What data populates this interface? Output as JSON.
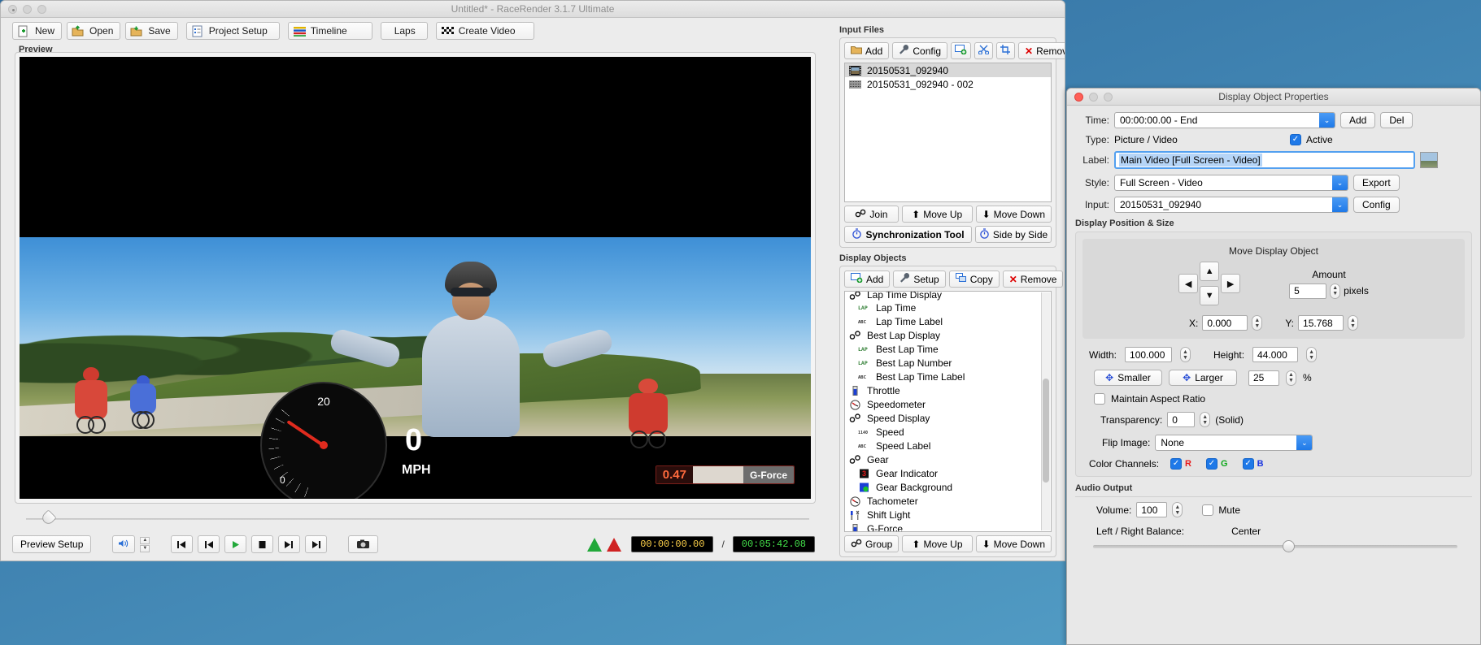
{
  "window": {
    "title": "Untitled* - RaceRender 3.1.7 Ultimate"
  },
  "toolbar": {
    "new": "New",
    "open": "Open",
    "save": "Save",
    "project_setup": "Project Setup",
    "timeline": "Timeline",
    "laps": "Laps",
    "create_video": "Create Video"
  },
  "preview": {
    "label": "Preview",
    "gauge_max_tick": "20",
    "gauge_min_tick": "0",
    "speed_value": "0",
    "speed_unit": "MPH",
    "gforce_value": "0.47",
    "gforce_label": "G-Force"
  },
  "transport": {
    "preview_setup": "Preview Setup",
    "current_time": "00:00:00.00",
    "separator": "/",
    "total_time": "00:05:42.08"
  },
  "input_files": {
    "title": "Input Files",
    "buttons": {
      "add": "Add",
      "config": "Config",
      "duplicate_icon": "add-screen-icon",
      "cut_icon": "scissors-icon",
      "crop_icon": "crop-icon",
      "remove": "Remove"
    },
    "items": [
      {
        "name": "20150531_092940",
        "icon": "film-strip-icon",
        "selected": true
      },
      {
        "name": "20150531_092940 - 002",
        "icon": "data-strip-icon",
        "selected": false
      }
    ],
    "footer": {
      "join": "Join",
      "move_up": "Move Up",
      "move_down": "Move Down",
      "sync_tool": "Synchronization Tool",
      "side_by_side": "Side by Side"
    }
  },
  "display_objects": {
    "title": "Display Objects",
    "buttons": {
      "add": "Add",
      "setup": "Setup",
      "copy": "Copy",
      "remove": "Remove"
    },
    "items": [
      {
        "label": "Lap Time Display",
        "icon": "link-icon",
        "indent": 0,
        "selected": false,
        "clipped": true
      },
      {
        "label": "Lap Time",
        "icon": "lap-icon",
        "indent": 1,
        "selected": false
      },
      {
        "label": "Lap Time Label",
        "icon": "abc-icon",
        "indent": 1,
        "selected": false
      },
      {
        "label": "Best Lap Display",
        "icon": "link-icon",
        "indent": 0,
        "selected": false
      },
      {
        "label": "Best Lap Time",
        "icon": "lap-icon",
        "indent": 1,
        "selected": false
      },
      {
        "label": "Best Lap Number",
        "icon": "lap-icon",
        "indent": 1,
        "selected": false
      },
      {
        "label": "Best Lap Time Label",
        "icon": "abc-icon",
        "indent": 1,
        "selected": false
      },
      {
        "label": "Throttle",
        "icon": "throttle-icon",
        "indent": 0,
        "selected": false
      },
      {
        "label": "Speedometer",
        "icon": "gauge-icon",
        "indent": 0,
        "selected": false
      },
      {
        "label": "Speed Display",
        "icon": "link-icon",
        "indent": 0,
        "selected": false
      },
      {
        "label": "Speed",
        "icon": "number-icon",
        "indent": 1,
        "selected": false
      },
      {
        "label": "Speed Label",
        "icon": "abc-icon",
        "indent": 1,
        "selected": false
      },
      {
        "label": "Gear",
        "icon": "link-icon",
        "indent": 0,
        "selected": false
      },
      {
        "label": "Gear Indicator",
        "icon": "gear-number-icon",
        "indent": 1,
        "selected": false
      },
      {
        "label": "Gear Background",
        "icon": "background-icon",
        "indent": 1,
        "selected": false
      },
      {
        "label": "Tachometer",
        "icon": "gauge-icon",
        "indent": 0,
        "selected": false
      },
      {
        "label": "Shift Light",
        "icon": "shift-light-icon",
        "indent": 0,
        "selected": false
      },
      {
        "label": "G-Force",
        "icon": "throttle-icon",
        "indent": 0,
        "selected": false
      },
      {
        "label": "Main Video [Full Screen - Video]",
        "icon": "film-strip-icon",
        "indent": 0,
        "selected": true
      }
    ],
    "footer": {
      "group": "Group",
      "move_up": "Move Up",
      "move_down": "Move Down"
    }
  },
  "properties": {
    "title": "Display Object Properties",
    "time": {
      "label": "Time:",
      "value": "00:00:00.00 - End",
      "add": "Add",
      "del": "Del"
    },
    "type": {
      "label": "Type:",
      "value": "Picture / Video",
      "active_label": "Active",
      "active_checked": true
    },
    "label_row": {
      "label": "Label:",
      "value": "Main Video [Full Screen - Video]"
    },
    "style": {
      "label": "Style:",
      "value": "Full Screen - Video",
      "button": "Export"
    },
    "input": {
      "label": "Input:",
      "value": "20150531_092940",
      "button": "Config"
    },
    "position_section": {
      "title": "Display Position & Size",
      "move_title": "Move Display Object",
      "amount_label": "Amount",
      "amount_value": "5",
      "amount_unit": "pixels",
      "x_label": "X:",
      "x_value": "0.000",
      "y_label": "Y:",
      "y_value": "15.768",
      "width_label": "Width:",
      "width_value": "100.000",
      "height_label": "Height:",
      "height_value": "44.000",
      "smaller": "Smaller",
      "larger": "Larger",
      "scale_value": "25",
      "scale_unit": "%",
      "maintain_aspect_label": "Maintain Aspect Ratio",
      "maintain_aspect_checked": false,
      "transparency_label": "Transparency:",
      "transparency_value": "0",
      "transparency_state": "(Solid)",
      "flip_label": "Flip Image:",
      "flip_value": "None",
      "color_channels_label": "Color Channels:",
      "channels": [
        {
          "letter": "R",
          "color": "#e81919",
          "checked": true
        },
        {
          "letter": "G",
          "color": "#0fa81c",
          "checked": true
        },
        {
          "letter": "B",
          "color": "#1a35e0",
          "checked": true
        }
      ]
    },
    "audio_section": {
      "title": "Audio Output",
      "volume_label": "Volume:",
      "volume_value": "100",
      "mute_label": "Mute",
      "mute_checked": false,
      "balance_label": "Left / Right Balance:",
      "balance_value": "Center"
    }
  },
  "colors": {
    "accent": "#1f79e8",
    "window_bg": "#ececec",
    "selected_row": "#d8d8d8"
  }
}
